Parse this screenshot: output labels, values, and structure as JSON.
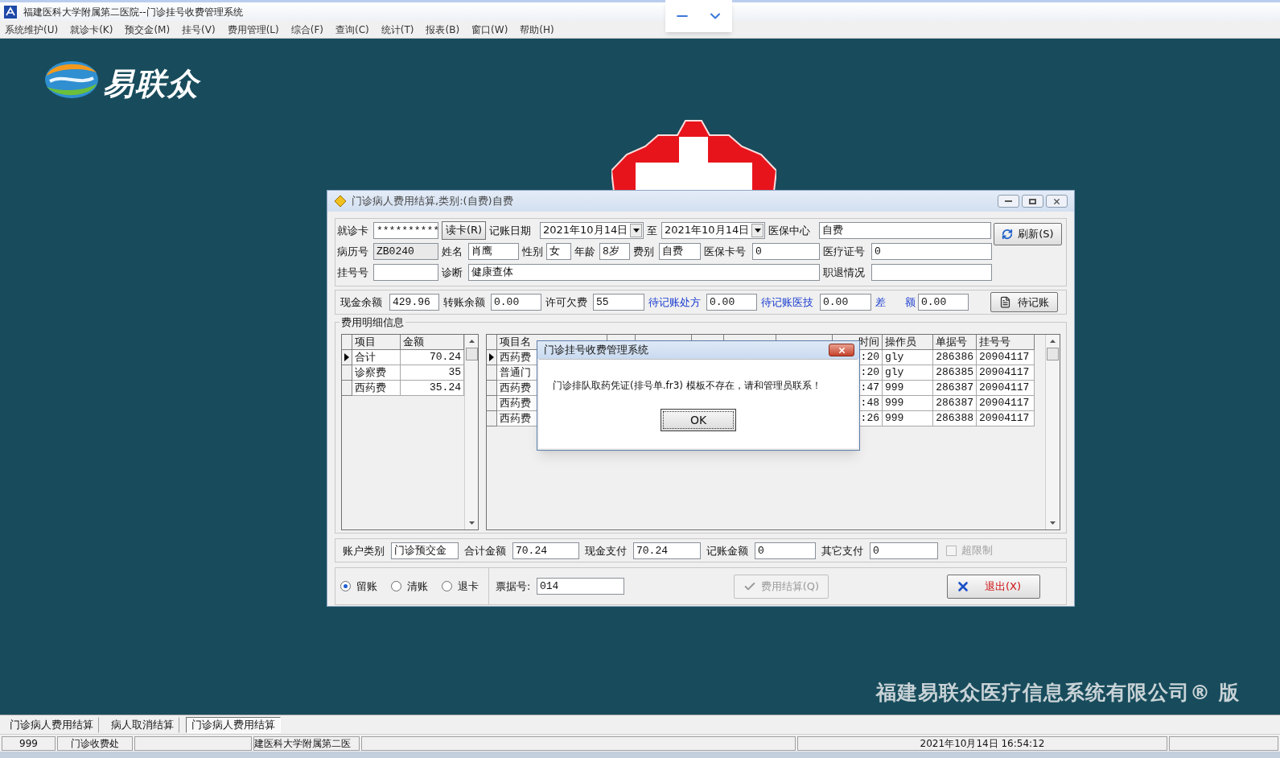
{
  "window": {
    "title": "福建医科大学附属第二医院--门诊挂号收费管理系统"
  },
  "menu": [
    "系统维护(U)",
    "就诊卡(K)",
    "预交金(M)",
    "挂号(V)",
    "费用管理(L)",
    "综合(F)",
    "查询(C)",
    "统计(T)",
    "报表(B)",
    "窗口(W)",
    "帮助(H)"
  ],
  "desktop": {
    "logo_text": "易联众",
    "footer_text": "福建易联众医疗信息系统有限公司® 版"
  },
  "settlement": {
    "title": "门诊病人费用结算,类别:(自费)自费",
    "header_rows": [
      [
        {
          "kind": "field",
          "label": "就诊卡",
          "value": "**********",
          "readonly": false
        },
        {
          "kind": "button",
          "label": "读卡(R)"
        },
        {
          "kind": "combo",
          "label": "记账日期",
          "value": "2021年10月14日"
        },
        {
          "kind": "combo",
          "label": "至",
          "value": "2021年10月14日"
        },
        {
          "kind": "field",
          "label": "医保中心",
          "value": "自费",
          "readonly": false
        }
      ],
      [
        {
          "kind": "field",
          "label": "病历号",
          "value": "ZB0240",
          "readonly": true
        },
        {
          "kind": "field",
          "label": "姓名",
          "value": "肖鹰",
          "readonly": false
        },
        {
          "kind": "field",
          "label": "性别",
          "value": "女",
          "readonly": false
        },
        {
          "kind": "field",
          "label": "年龄",
          "value": "8岁",
          "readonly": false
        },
        {
          "kind": "field",
          "label": "费别",
          "value": "自费",
          "readonly": false
        },
        {
          "kind": "field",
          "label": "医保卡号",
          "value": "0",
          "readonly": false
        },
        {
          "kind": "field",
          "label": "医疗证号",
          "value": "0",
          "readonly": false
        }
      ],
      [
        {
          "kind": "field",
          "label": "挂号号",
          "readonly": false
        },
        {
          "kind": "field",
          "label": "诊断",
          "value": "健康查体",
          "readonly": false
        },
        {
          "kind": "field",
          "label": "职退情况",
          "readonly": false
        }
      ]
    ],
    "refresh_button": "刷新(S)",
    "balances": [
      {
        "label": "现金余额",
        "value": "429.96",
        "pending": false
      },
      {
        "label": "转账余额",
        "value": "0.00",
        "pending": false
      },
      {
        "label": "许可欠费",
        "value": "55",
        "pending": false
      },
      {
        "label": "待记账处方",
        "value": "0.00",
        "pending": true
      },
      {
        "label": "待记账医技",
        "value": "0.00",
        "pending": true
      },
      {
        "label": "差 额",
        "value": "0.00",
        "pending": true
      }
    ],
    "pending_button": "待记账",
    "detail": {
      "title": "费用明细信息",
      "summary_columns": [
        "项目",
        "金额"
      ],
      "summary_rows": [
        {
          "cells": [
            "合计",
            "70.24"
          ],
          "selected": true
        },
        {
          "cells": [
            "诊察费",
            "35"
          ],
          "selected": false
        },
        {
          "cells": [
            "西药费",
            "35.24"
          ],
          "selected": false
        }
      ],
      "item_columns": {
        "name": "项目名",
        "time": "时间",
        "operator": "操作员",
        "receipt": "单据号",
        "registration": "挂号号"
      },
      "item_rows": [
        {
          "name": "西药费",
          "time": ":20",
          "operator": "gly",
          "receipt": "286386",
          "registration": "20904117",
          "selected": true
        },
        {
          "name": "普通门",
          "time": ":20",
          "operator": "gly",
          "receipt": "286385",
          "registration": "20904117",
          "selected": false
        },
        {
          "name": "西药费",
          "time": ":47",
          "operator": "999",
          "receipt": "286387",
          "registration": "20904117",
          "selected": false
        },
        {
          "name": "西药费",
          "time": ":48",
          "operator": "999",
          "receipt": "286387",
          "registration": "20904117",
          "selected": false
        },
        {
          "name": "西药费",
          "time": ":26",
          "operator": "999",
          "receipt": "286388",
          "registration": "20904117",
          "selected": false
        }
      ]
    },
    "totals": [
      {
        "label": "账户类别",
        "value": "门诊预交金"
      },
      {
        "label": "合计金额",
        "value": "70.24"
      },
      {
        "label": "现金支付",
        "value": "70.24"
      },
      {
        "label": "记账金额",
        "value": "0"
      },
      {
        "label": "其它支付",
        "value": "0"
      }
    ],
    "over_limit": {
      "label": "超限制",
      "checked": false,
      "disabled": true
    },
    "modes": [
      {
        "label": "留账",
        "selected": true
      },
      {
        "label": "清账",
        "selected": false
      },
      {
        "label": "退卡",
        "selected": false
      }
    ],
    "receipt": {
      "label": "票据号:",
      "value": "014"
    },
    "settle_button": {
      "label": "费用结算(Q)",
      "disabled": true
    },
    "exit_button": "退出(X)"
  },
  "message_box": {
    "title": "门诊挂号收费管理系统",
    "message": "门诊排队取药凭证(排号单.fr3) 模板不存在，请和管理员联系！",
    "button": "OK"
  },
  "tabs": [
    {
      "label": "门诊病人费用结算",
      "selected": false
    },
    {
      "label": "病人取消结算",
      "selected": false
    },
    {
      "label": "门诊病人费用结算",
      "selected": true
    }
  ],
  "status_bar": [
    "999",
    "门诊收费处",
    "建医科大学附属第二医",
    "2021年10月14日 16:54:12"
  ]
}
